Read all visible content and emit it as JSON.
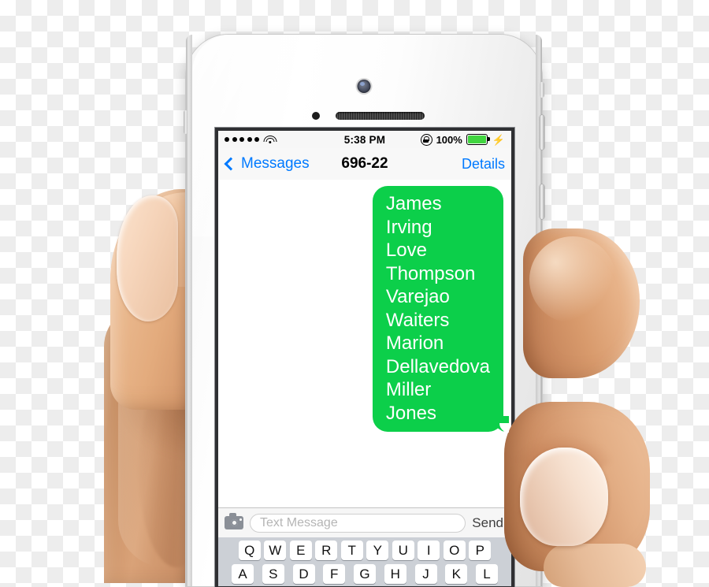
{
  "device": {
    "name": "iphone-5s-white",
    "hardware": {
      "front_camera": "front-camera",
      "proximity_sensor": "proximity-sensor",
      "earpiece_speaker": "earpiece-speaker"
    }
  },
  "status_bar": {
    "signal_dots": 5,
    "wifi": "wifi-icon",
    "time": "5:38 PM",
    "rotation_lock": "rotation-lock-icon",
    "battery_percent": "100%",
    "battery_color": "#41d540",
    "charging": "⚡"
  },
  "nav_bar": {
    "back_label": "Messages",
    "title": "696-22",
    "details_label": "Details",
    "tint_color": "#007aff"
  },
  "conversation": {
    "bubble_color": "#0ccf4a",
    "bubble_text_color": "#ffffff",
    "messages": [
      {
        "side": "outgoing",
        "lines": [
          "James",
          "Irving",
          "Love",
          "Thompson",
          "Varejao",
          "Waiters",
          "Marion",
          "Dellavedova",
          "Miller",
          "Jones"
        ]
      }
    ]
  },
  "input_bar": {
    "camera_icon": "camera-icon",
    "placeholder": "Text Message",
    "value": "",
    "send_label": "Send"
  },
  "keyboard": {
    "row1": [
      "Q",
      "W",
      "E",
      "R",
      "T",
      "Y",
      "U",
      "I",
      "O",
      "P"
    ],
    "row2": [
      "A",
      "S",
      "D",
      "F",
      "G",
      "H",
      "J",
      "K",
      "L"
    ]
  }
}
